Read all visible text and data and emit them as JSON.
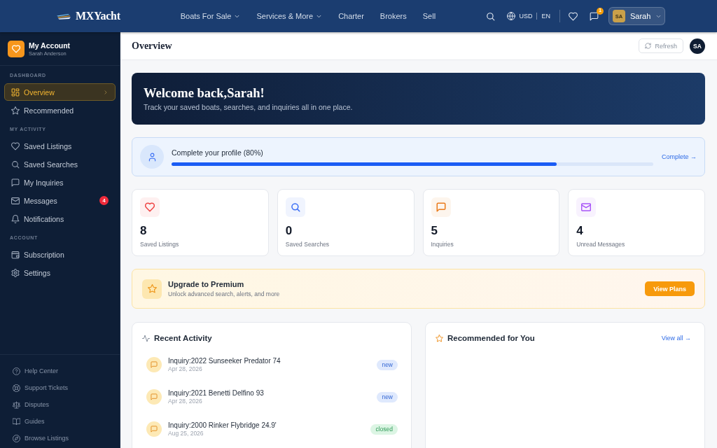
{
  "top_nav": {
    "logo": "MXYacht",
    "links": [
      {
        "label": "Boats For Sale",
        "has_menu": true
      },
      {
        "label": "Services & More",
        "has_menu": true
      },
      {
        "label": "Charter",
        "has_menu": false
      },
      {
        "label": "Brokers",
        "has_menu": false
      },
      {
        "label": "Sell",
        "has_menu": false
      }
    ],
    "currency": "USD",
    "language": "EN",
    "messages_badge": "1",
    "user": {
      "initials": "SA",
      "name": "Sarah"
    }
  },
  "sidebar": {
    "account": {
      "title": "My Account",
      "name": "Sarah Anderson"
    },
    "sections": [
      {
        "heading": "DASHBOARD",
        "items": [
          {
            "label": "Overview",
            "selected": true
          },
          {
            "label": "Recommended",
            "selected": false
          }
        ]
      },
      {
        "heading": "MY ACTIVITY",
        "items": [
          {
            "label": "Saved Listings",
            "selected": false
          },
          {
            "label": "Saved Searches",
            "selected": false
          },
          {
            "label": "My Inquiries",
            "selected": false
          },
          {
            "label": "Messages",
            "selected": false,
            "badge": "4"
          },
          {
            "label": "Notifications",
            "selected": false
          }
        ]
      },
      {
        "heading": "ACCOUNT",
        "items": [
          {
            "label": "Subscription",
            "selected": false
          },
          {
            "label": "Settings",
            "selected": false
          }
        ]
      }
    ],
    "footer_items": [
      {
        "label": "Help Center",
        "selected": false
      },
      {
        "label": "Support Tickets",
        "selected": false
      },
      {
        "label": "Disputes",
        "selected": false
      },
      {
        "label": "Guides",
        "selected": false
      },
      {
        "label": "Browse Listings",
        "selected": false
      }
    ]
  },
  "header": {
    "title": "Overview",
    "refresh": "Refresh",
    "avatar": "SA"
  },
  "welcome": {
    "title": "Welcome back,Sarah!",
    "subtitle": "Track your saved boats, searches, and inquiries all in one place."
  },
  "profile": {
    "label": "Complete your profile (80%)",
    "level": 0.8,
    "link": "Complete →"
  },
  "stats": [
    {
      "value": "8",
      "label": "Saved Listings",
      "color": "#ef4444"
    },
    {
      "value": "0",
      "label": "Saved Searches",
      "color": "#3b6ff5"
    },
    {
      "value": "5",
      "label": "Inquiries",
      "color": "#ea7b1c"
    },
    {
      "value": "4",
      "label": "Unread Messages",
      "color": "#a855f7"
    }
  ],
  "upgrade": {
    "title": "Upgrade to Premium",
    "subtitle": "Unlock advanced search, alerts, and more",
    "button": "View Plans"
  },
  "recent_activity": {
    "title": "Recent Activity",
    "items": [
      {
        "title": "Inquiry:2022 Sunseeker Predator 74",
        "date": "Apr 28, 2026",
        "status": "new",
        "kind": "open"
      },
      {
        "title": "Inquiry:2021 Benetti Delfino 93",
        "date": "Apr 28, 2026",
        "status": "new",
        "kind": "open"
      },
      {
        "title": "Inquiry:2000 Rinker Flybridge 24.9'",
        "date": "Aug 25, 2026",
        "status": "closed",
        "kind": "closed"
      }
    ]
  },
  "recommended": {
    "title": "Recommended for You",
    "link": "View all →"
  }
}
